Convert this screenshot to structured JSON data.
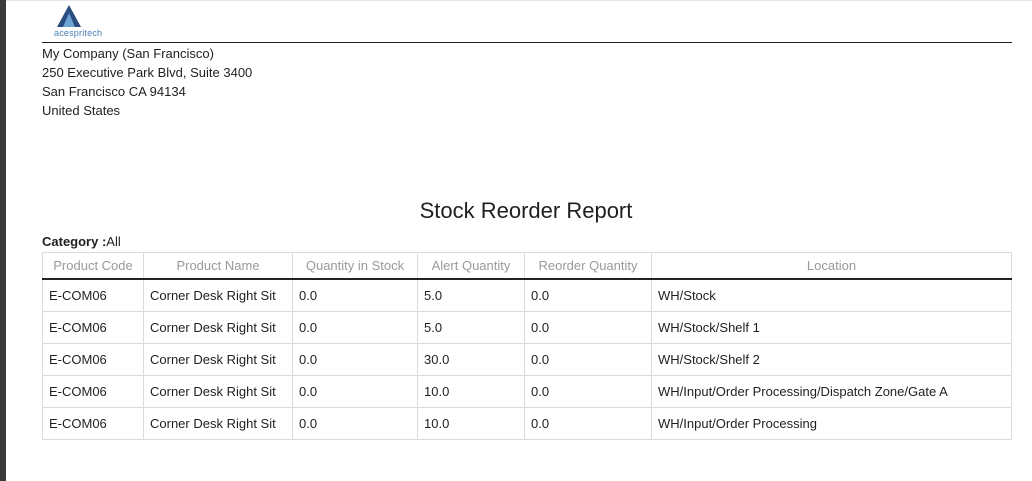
{
  "logo": {
    "text": "acespritech",
    "icon": "triangle-logo-icon",
    "color_dark": "#2b4c7e",
    "color_light": "#6fa3d6"
  },
  "company": {
    "name": "My Company (San Francisco)",
    "street": "250 Executive Park Blvd, Suite 3400",
    "city_line": "San Francisco CA 94134",
    "country": "United States"
  },
  "report": {
    "title": "Stock Reorder Report",
    "category_label": "Category :",
    "category_value": "All"
  },
  "table": {
    "headers": [
      "Product Code",
      "Product Name",
      "Quantity in Stock",
      "Alert Quantity",
      "Reorder Quantity",
      "Location"
    ],
    "rows": [
      [
        "E-COM06",
        "Corner Desk Right Sit",
        "0.0",
        "5.0",
        "0.0",
        "WH/Stock"
      ],
      [
        "E-COM06",
        "Corner Desk Right Sit",
        "0.0",
        "5.0",
        "0.0",
        "WH/Stock/Shelf 1"
      ],
      [
        "E-COM06",
        "Corner Desk Right Sit",
        "0.0",
        "30.0",
        "0.0",
        "WH/Stock/Shelf 2"
      ],
      [
        "E-COM06",
        "Corner Desk Right Sit",
        "0.0",
        "10.0",
        "0.0",
        "WH/Input/Order Processing/Dispatch Zone/Gate A"
      ],
      [
        "E-COM06",
        "Corner Desk Right Sit",
        "0.0",
        "10.0",
        "0.0",
        "WH/Input/Order Processing"
      ]
    ]
  }
}
